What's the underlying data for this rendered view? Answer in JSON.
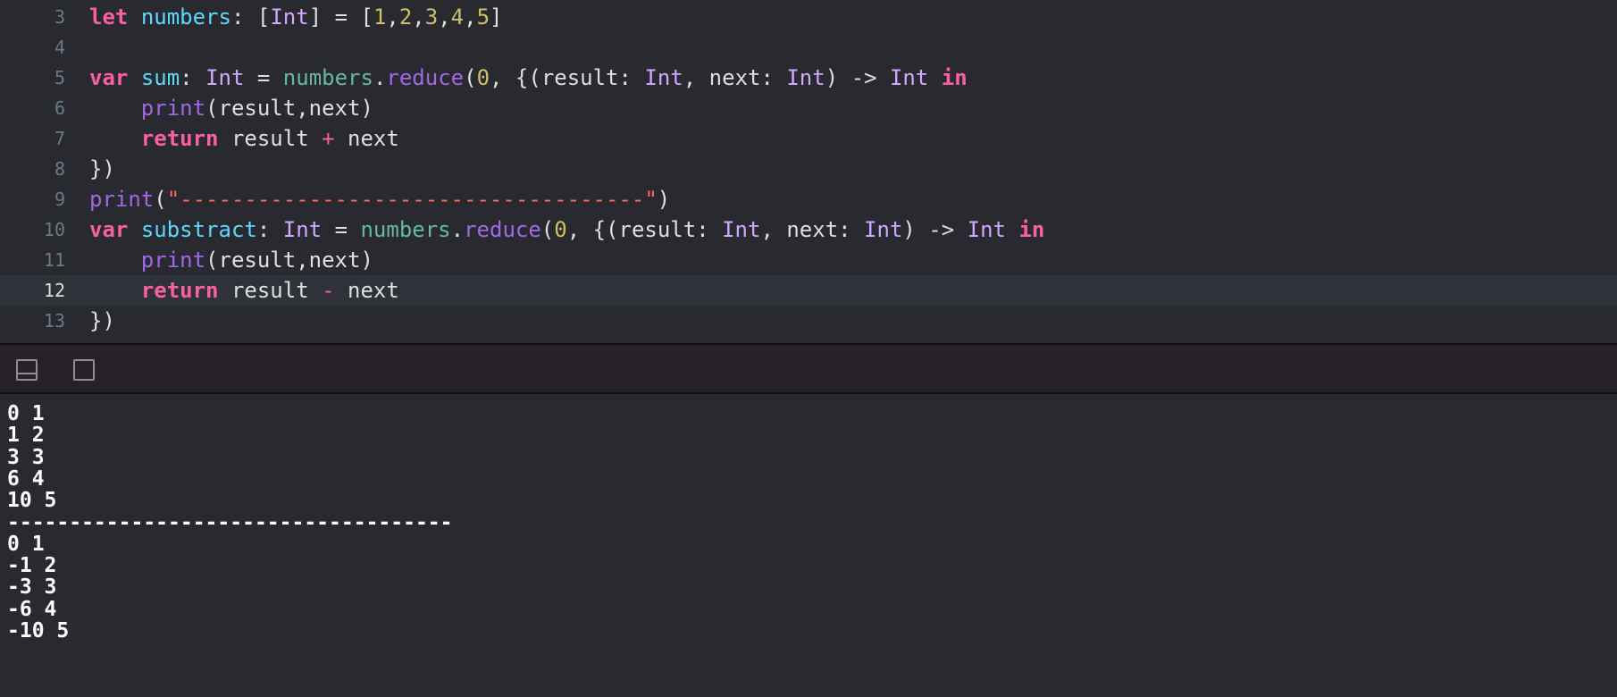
{
  "editor": {
    "lines": [
      {
        "number": "3",
        "current": false,
        "tokens": [
          {
            "t": "let",
            "c": "keyword"
          },
          {
            "t": " ",
            "c": "plain"
          },
          {
            "t": "numbers",
            "c": "decl"
          },
          {
            "t": ": [",
            "c": "plain"
          },
          {
            "t": "Int",
            "c": "type"
          },
          {
            "t": "] = [",
            "c": "plain"
          },
          {
            "t": "1",
            "c": "num"
          },
          {
            "t": ",",
            "c": "plain"
          },
          {
            "t": "2",
            "c": "num"
          },
          {
            "t": ",",
            "c": "plain"
          },
          {
            "t": "3",
            "c": "num"
          },
          {
            "t": ",",
            "c": "plain"
          },
          {
            "t": "4",
            "c": "num"
          },
          {
            "t": ",",
            "c": "plain"
          },
          {
            "t": "5",
            "c": "num"
          },
          {
            "t": "]",
            "c": "plain"
          }
        ]
      },
      {
        "number": "4",
        "current": false,
        "tokens": []
      },
      {
        "number": "5",
        "current": false,
        "tokens": [
          {
            "t": "var",
            "c": "keyword"
          },
          {
            "t": " ",
            "c": "plain"
          },
          {
            "t": "sum",
            "c": "decl"
          },
          {
            "t": ": ",
            "c": "plain"
          },
          {
            "t": "Int",
            "c": "type"
          },
          {
            "t": " = ",
            "c": "plain"
          },
          {
            "t": "numbers",
            "c": "var"
          },
          {
            "t": ".",
            "c": "plain"
          },
          {
            "t": "reduce",
            "c": "func"
          },
          {
            "t": "(",
            "c": "plain"
          },
          {
            "t": "0",
            "c": "num"
          },
          {
            "t": ", {(result: ",
            "c": "plain"
          },
          {
            "t": "Int",
            "c": "type"
          },
          {
            "t": ", next: ",
            "c": "plain"
          },
          {
            "t": "Int",
            "c": "type"
          },
          {
            "t": ") -> ",
            "c": "plain"
          },
          {
            "t": "Int",
            "c": "type"
          },
          {
            "t": " ",
            "c": "plain"
          },
          {
            "t": "in",
            "c": "keyword"
          }
        ]
      },
      {
        "number": "6",
        "current": false,
        "tokens": [
          {
            "t": "    ",
            "c": "plain"
          },
          {
            "t": "print",
            "c": "func"
          },
          {
            "t": "(result,next)",
            "c": "plain"
          }
        ]
      },
      {
        "number": "7",
        "current": false,
        "tokens": [
          {
            "t": "    ",
            "c": "plain"
          },
          {
            "t": "return",
            "c": "keyword"
          },
          {
            "t": " result ",
            "c": "plain"
          },
          {
            "t": "+",
            "c": "op"
          },
          {
            "t": " next",
            "c": "plain"
          }
        ]
      },
      {
        "number": "8",
        "current": false,
        "tokens": [
          {
            "t": "})",
            "c": "plain"
          }
        ]
      },
      {
        "number": "9",
        "current": false,
        "tokens": [
          {
            "t": "print",
            "c": "func"
          },
          {
            "t": "(",
            "c": "plain"
          },
          {
            "t": "\"------------------------------------\"",
            "c": "str"
          },
          {
            "t": ")",
            "c": "plain"
          }
        ]
      },
      {
        "number": "10",
        "current": false,
        "tokens": [
          {
            "t": "var",
            "c": "keyword"
          },
          {
            "t": " ",
            "c": "plain"
          },
          {
            "t": "substract",
            "c": "decl"
          },
          {
            "t": ": ",
            "c": "plain"
          },
          {
            "t": "Int",
            "c": "type"
          },
          {
            "t": " = ",
            "c": "plain"
          },
          {
            "t": "numbers",
            "c": "var"
          },
          {
            "t": ".",
            "c": "plain"
          },
          {
            "t": "reduce",
            "c": "func"
          },
          {
            "t": "(",
            "c": "plain"
          },
          {
            "t": "0",
            "c": "num"
          },
          {
            "t": ", {(result: ",
            "c": "plain"
          },
          {
            "t": "Int",
            "c": "type"
          },
          {
            "t": ", next: ",
            "c": "plain"
          },
          {
            "t": "Int",
            "c": "type"
          },
          {
            "t": ") -> ",
            "c": "plain"
          },
          {
            "t": "Int",
            "c": "type"
          },
          {
            "t": " ",
            "c": "plain"
          },
          {
            "t": "in",
            "c": "keyword"
          }
        ]
      },
      {
        "number": "11",
        "current": false,
        "tokens": [
          {
            "t": "    ",
            "c": "plain"
          },
          {
            "t": "print",
            "c": "func"
          },
          {
            "t": "(result,next)",
            "c": "plain"
          }
        ]
      },
      {
        "number": "12",
        "current": true,
        "tokens": [
          {
            "t": "    ",
            "c": "plain"
          },
          {
            "t": "return",
            "c": "keyword"
          },
          {
            "t": " result ",
            "c": "plain"
          },
          {
            "t": "-",
            "c": "op"
          },
          {
            "t": " next",
            "c": "plain"
          }
        ]
      },
      {
        "number": "13",
        "current": false,
        "tokens": [
          {
            "t": "})",
            "c": "plain"
          }
        ]
      }
    ]
  },
  "console_toolbar": {
    "buttons": [
      {
        "icon": "hide-debug-area-icon"
      },
      {
        "icon": "split-view-icon"
      }
    ]
  },
  "console": {
    "lines": [
      "0 1",
      "1 2",
      "3 3",
      "6 4",
      "10 5",
      "------------------------------------",
      "0 1",
      "-1 2",
      "-3 3",
      "-6 4",
      "-10 5"
    ]
  }
}
